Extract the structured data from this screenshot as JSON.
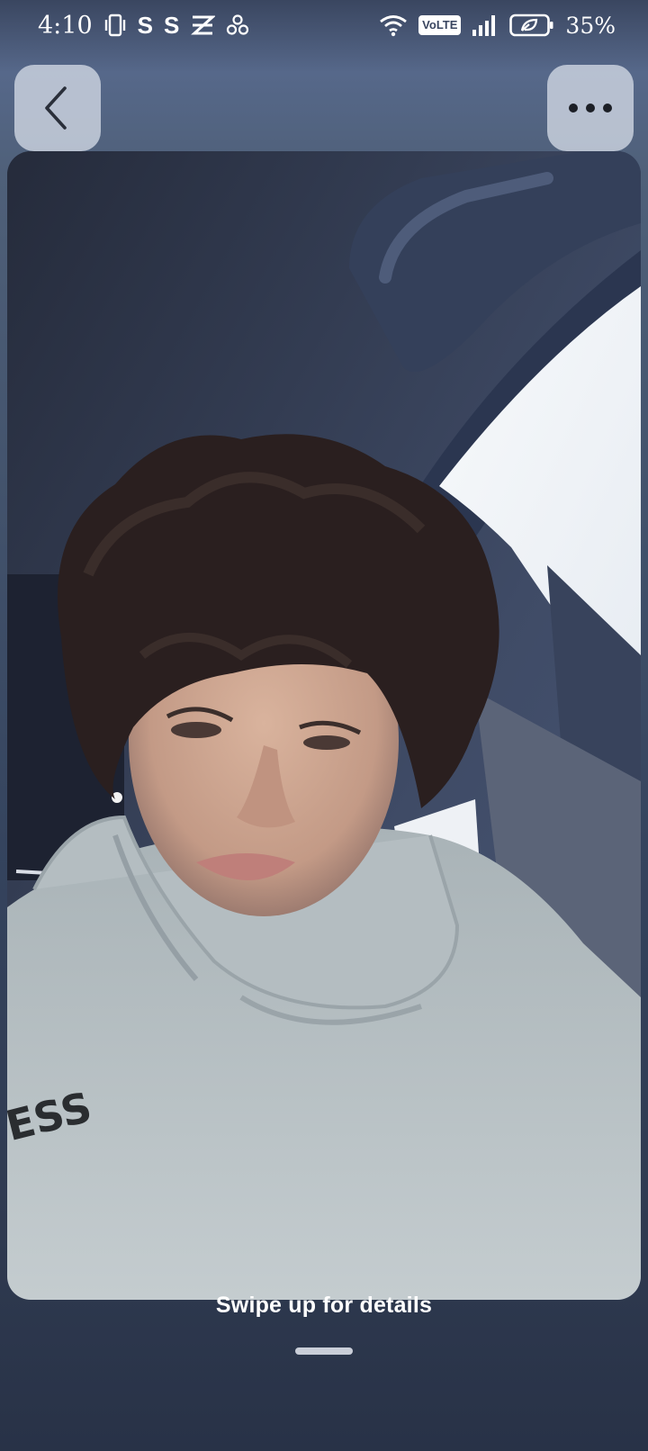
{
  "status_bar": {
    "time": "4:10",
    "left_icons": [
      "vibrate-icon",
      "s-app-icon",
      "s-app-icon",
      "capcut-icon",
      "fan-icon"
    ],
    "s_glyph": "S",
    "volte_label": "VoLTE",
    "battery_percent": "35%",
    "right_icons": [
      "wifi-icon",
      "volte-icon",
      "signal-icon",
      "battery-saver-icon"
    ]
  },
  "header": {
    "back_icon": "chevron-left-icon",
    "more_icon": "more-horizontal-icon"
  },
  "photo": {
    "subject": "selfie-photo"
  },
  "footer": {
    "swipe_hint": "Swipe up for details"
  },
  "colors": {
    "background_top": "#56688a",
    "background_bottom": "#283247",
    "button_bg": "#cdd4e0",
    "text": "#ffffff"
  }
}
